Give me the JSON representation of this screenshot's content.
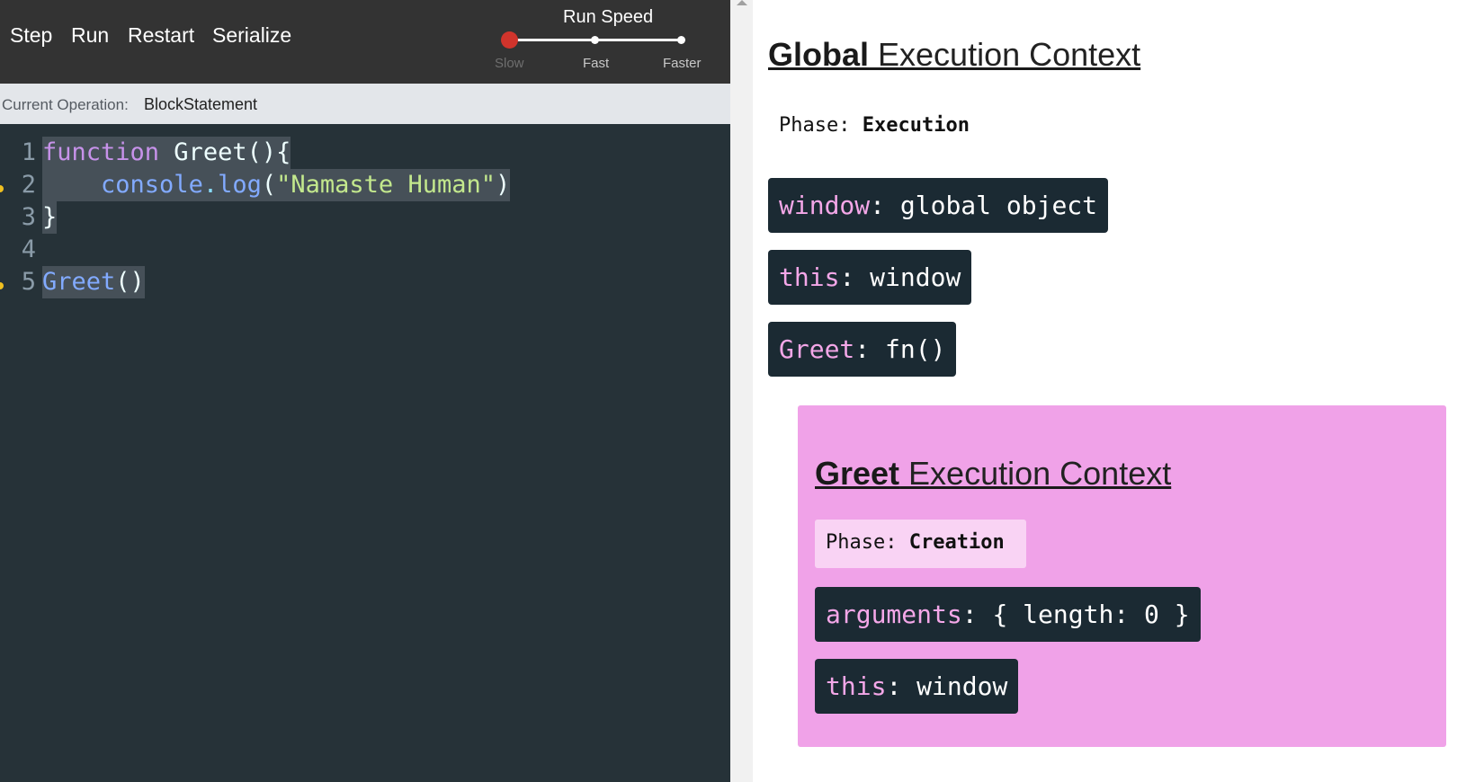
{
  "toolbar": {
    "buttons": [
      "Step",
      "Run",
      "Restart",
      "Serialize"
    ],
    "speed": {
      "title": "Run Speed",
      "labels": [
        "Slow",
        "Fast",
        "Faster"
      ],
      "selected": "Slow",
      "accent_color": "#d0342c"
    }
  },
  "operation": {
    "label": "Current Operation:",
    "value": "BlockStatement"
  },
  "editor": {
    "line_numbers": [
      "1",
      "2",
      "3",
      "4",
      "5"
    ],
    "lines": [
      {
        "text": "function Greet(){"
      },
      {
        "text": "    console.log(\"Namaste Human\")"
      },
      {
        "text": "}"
      },
      {
        "text": ""
      },
      {
        "text": "Greet()"
      }
    ],
    "tokens": {
      "l1_kw": "function",
      "l1_name": " Greet",
      "l1_punc": "(){",
      "l2_indent": "    ",
      "l2_obj": "console",
      "l2_dot": ".",
      "l2_method": "log",
      "l2_open": "(",
      "l2_str": "\"Namaste Human\"",
      "l2_close": ")",
      "l3_punc": "}",
      "l5_name": "Greet",
      "l5_punc": "()"
    }
  },
  "global_context": {
    "title_bold": "Global",
    "title_rest": " Execution Context",
    "phase_label": "Phase:",
    "phase_value": "Execution",
    "entries": [
      {
        "key": "window",
        "value": "global object"
      },
      {
        "key": "this",
        "value": "window"
      },
      {
        "key": "Greet",
        "value": "fn()"
      }
    ]
  },
  "greet_context": {
    "title_bold": "Greet",
    "title_rest": " Execution Context",
    "phase_label": "Phase:",
    "phase_value": "Creation",
    "entries": [
      {
        "key": "arguments",
        "value": "{ length: 0 }"
      },
      {
        "key": "this",
        "value": "window"
      }
    ],
    "background": "#f0a2e8"
  }
}
